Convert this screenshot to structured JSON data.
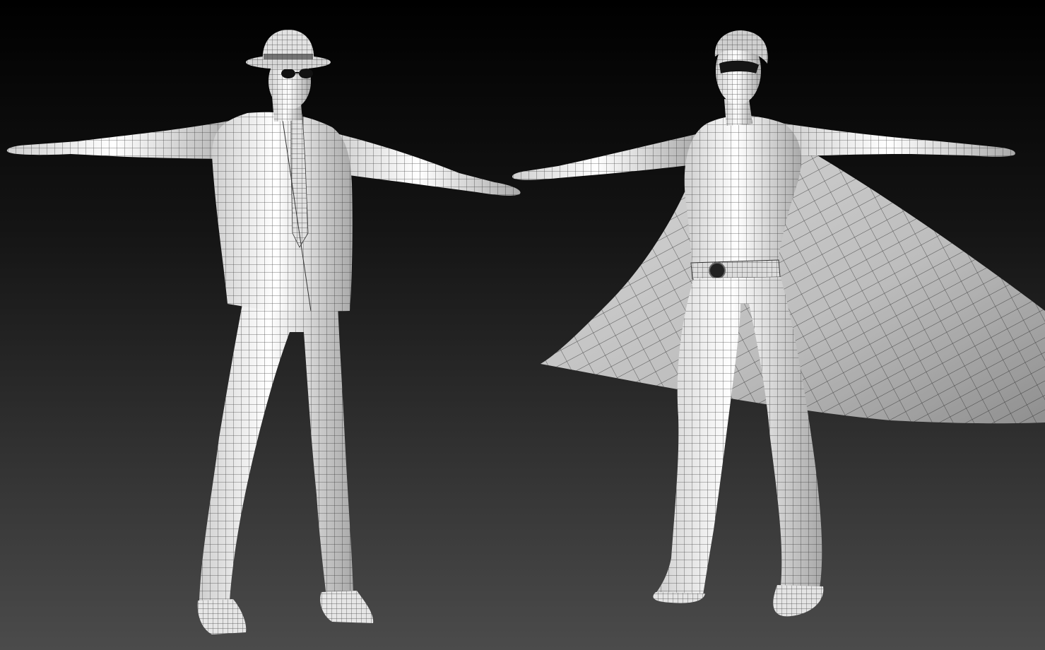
{
  "scene": {
    "background_top": "#000000",
    "background_bottom": "#4a4a4a",
    "surface_color": "#f2f2f2",
    "surface_shadow": "#9a9a9a",
    "wire_color": "#1a1a1a",
    "models": [
      {
        "name": "suit-man",
        "accessories": [
          "fedora-hat",
          "sunglasses",
          "necktie",
          "suit-jacket"
        ]
      },
      {
        "name": "caped-hero",
        "accessories": [
          "cape",
          "belt",
          "belt-buckle",
          "mask"
        ]
      }
    ]
  }
}
